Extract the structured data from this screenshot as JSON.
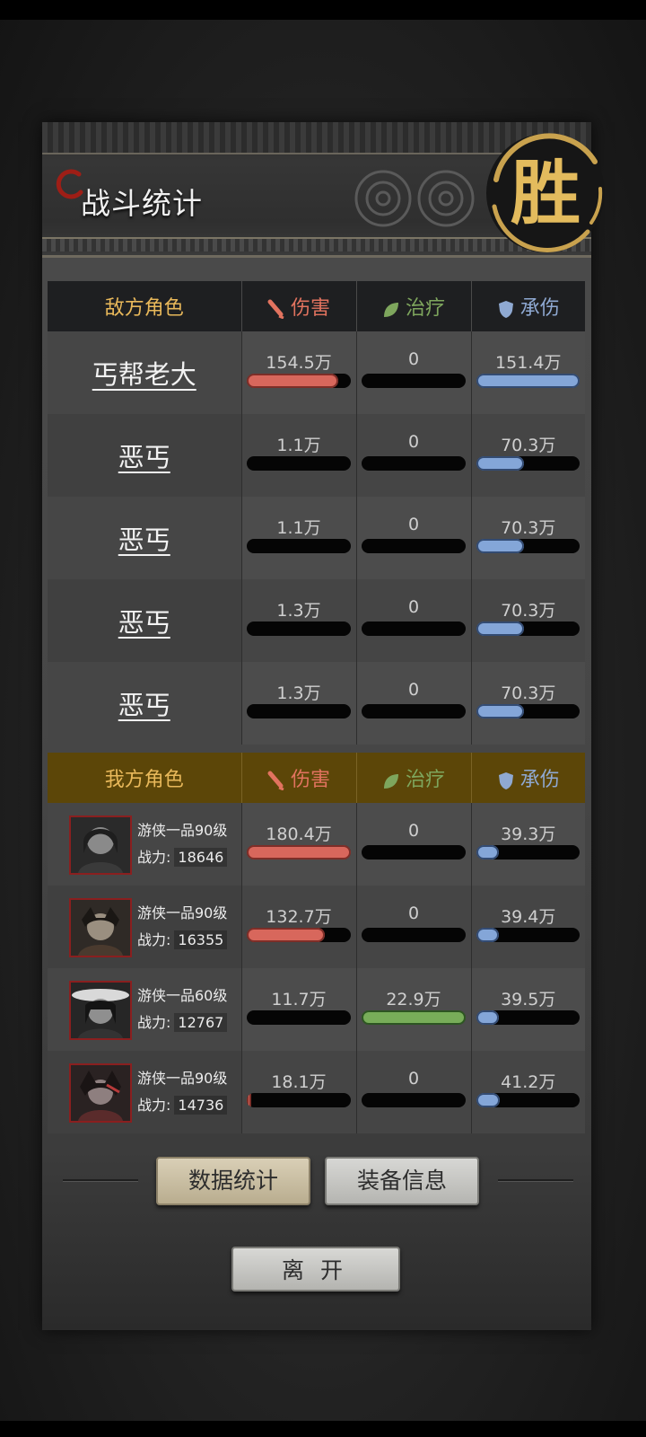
{
  "title": "战斗统计",
  "victory_char": "胜",
  "colors": {
    "damage": "#d8675c",
    "heal": "#78ad59",
    "tank": "#84a6d8",
    "gold": "#e8b85a",
    "ally_header": "#5c4608"
  },
  "enemy": {
    "header": {
      "role": "敌方角色",
      "damage": "伤害",
      "heal": "治疗",
      "tank": "承伤"
    },
    "rows": [
      {
        "name": "丐帮老大",
        "damage": "154.5万",
        "damage_frac": 0.88,
        "heal": "0",
        "heal_frac": 0,
        "tank": "151.4万",
        "tank_frac": 1.0
      },
      {
        "name": "恶丐",
        "damage": "1.1万",
        "damage_frac": 0,
        "heal": "0",
        "heal_frac": 0,
        "tank": "70.3万",
        "tank_frac": 0.46
      },
      {
        "name": "恶丐",
        "damage": "1.1万",
        "damage_frac": 0,
        "heal": "0",
        "heal_frac": 0,
        "tank": "70.3万",
        "tank_frac": 0.46
      },
      {
        "name": "恶丐",
        "damage": "1.3万",
        "damage_frac": 0,
        "heal": "0",
        "heal_frac": 0,
        "tank": "70.3万",
        "tank_frac": 0.46
      },
      {
        "name": "恶丐",
        "damage": "1.3万",
        "damage_frac": 0,
        "heal": "0",
        "heal_frac": 0,
        "tank": "70.3万",
        "tank_frac": 0.46
      }
    ]
  },
  "ally": {
    "header": {
      "role": "我方角色",
      "damage": "伤害",
      "heal": "治疗",
      "tank": "承伤"
    },
    "rows": [
      {
        "level": "游侠一品90级",
        "power_label": "战力:",
        "power": "18646",
        "damage": "180.4万",
        "damage_frac": 1.0,
        "heal": "0",
        "heal_frac": 0,
        "tank": "39.3万",
        "tank_frac": 0.22
      },
      {
        "level": "游侠一品90级",
        "power_label": "战力:",
        "power": "16355",
        "damage": "132.7万",
        "damage_frac": 0.75,
        "heal": "0",
        "heal_frac": 0,
        "tank": "39.4万",
        "tank_frac": 0.22
      },
      {
        "level": "游侠一品60级",
        "power_label": "战力:",
        "power": "12767",
        "damage": "11.7万",
        "damage_frac": 0,
        "heal": "22.9万",
        "heal_frac": 1.0,
        "tank": "39.5万",
        "tank_frac": 0.22
      },
      {
        "level": "游侠一品90级",
        "power_label": "战力:",
        "power": "14736",
        "damage": "18.1万",
        "damage_frac": 0.05,
        "heal": "0",
        "heal_frac": 0,
        "tank": "41.2万",
        "tank_frac": 0.23
      }
    ]
  },
  "buttons": {
    "data": "数据统计",
    "equip": "装备信息",
    "leave": "离开"
  }
}
